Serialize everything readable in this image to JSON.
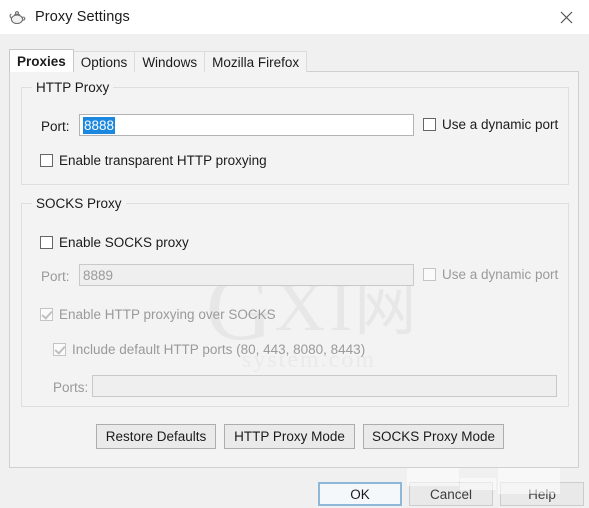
{
  "window": {
    "title": "Proxy Settings",
    "icon": "teapot-icon",
    "close_label": "✕"
  },
  "tabs": [
    {
      "label": "Proxies",
      "selected": true
    },
    {
      "label": "Options",
      "selected": false
    },
    {
      "label": "Windows",
      "selected": false
    },
    {
      "label": "Mozilla Firefox",
      "selected": false
    }
  ],
  "http_proxy": {
    "legend": "HTTP Proxy",
    "port_label": "Port:",
    "port_value": "8888",
    "port_selected": true,
    "dynamic_port": {
      "label": "Use a dynamic port",
      "checked": false,
      "enabled": true
    },
    "transparent": {
      "label": "Enable transparent HTTP proxying",
      "checked": false,
      "enabled": true
    }
  },
  "socks_proxy": {
    "legend": "SOCKS Proxy",
    "enable": {
      "label": "Enable SOCKS proxy",
      "checked": false,
      "enabled": true
    },
    "port_label": "Port:",
    "port_value": "8889",
    "dynamic_port": {
      "label": "Use a dynamic port",
      "checked": false,
      "enabled": false
    },
    "http_over_socks": {
      "label": "Enable HTTP proxying over SOCKS",
      "checked": true,
      "enabled": false
    },
    "include_default_ports": {
      "label": "Include default HTTP ports (80, 443, 8080, 8443)",
      "checked": true,
      "enabled": false
    },
    "ports_label": "Ports:",
    "ports_value": ""
  },
  "mode_buttons": {
    "restore_defaults": "Restore Defaults",
    "http_proxy_mode": "HTTP Proxy Mode",
    "socks_proxy_mode": "SOCKS Proxy Mode"
  },
  "dialog_buttons": {
    "ok": "OK",
    "cancel": "Cancel",
    "help": "Help"
  },
  "watermark": {
    "g": "G",
    "x": "X",
    "bar": "I",
    "cn": "网",
    "sub": "system.com"
  },
  "colors": {
    "selection_blue": "#1b87de",
    "default_button_border": "#8fb8d8",
    "panel_bg": "#f3f3f3",
    "titlebar_bg": "#ffffff"
  }
}
